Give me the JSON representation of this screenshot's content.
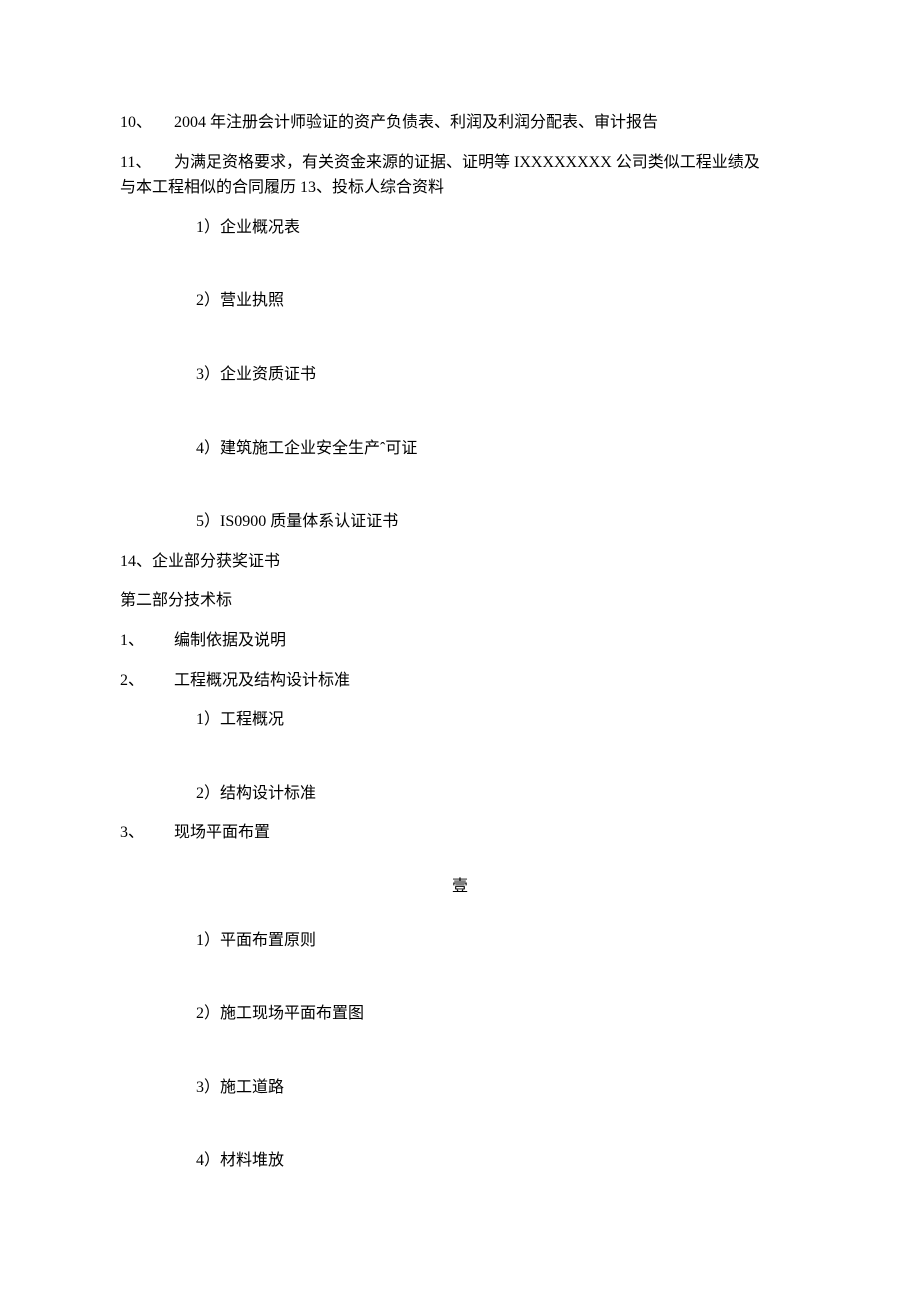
{
  "items": {
    "i10": {
      "num": "10、",
      "text": "2004 年注册会计师验证的资产负债表、利润及利润分配表、审计报告"
    },
    "i11": {
      "num": "11、",
      "text_line1": "为满足资格要求，有关资金来源的证据、证明等 IXXXXXXXX 公司类似工程业绩及",
      "text_line2": "与本工程相似的合同履历 13、投标人综合资料"
    },
    "s13": {
      "p1": "1）企业概况表",
      "p2": "2）营业执照",
      "p3": "3）企业资质证书",
      "p4": "4）建筑施工企业安全生产ˆ可证",
      "p5": "5）IS0900 质量体系认证证书"
    },
    "i14": {
      "num": "14、",
      "text": "企业部分获奖证书"
    },
    "part2_title": "第二部分技术标",
    "p2_1": {
      "num": "1、",
      "text": "编制依据及说明"
    },
    "p2_2": {
      "num": "2、",
      "text": "工程概况及结构设计标准",
      "s1": "1）工程概况",
      "s2": "2）结构设计标准"
    },
    "p2_3": {
      "num": "3、",
      "text": "现场平面布置",
      "s1": "1）平面布置原则",
      "s2": "2）施工现场平面布置图",
      "s3": "3）施工道路",
      "s4": "4）材料堆放"
    }
  },
  "page_number": "壹"
}
